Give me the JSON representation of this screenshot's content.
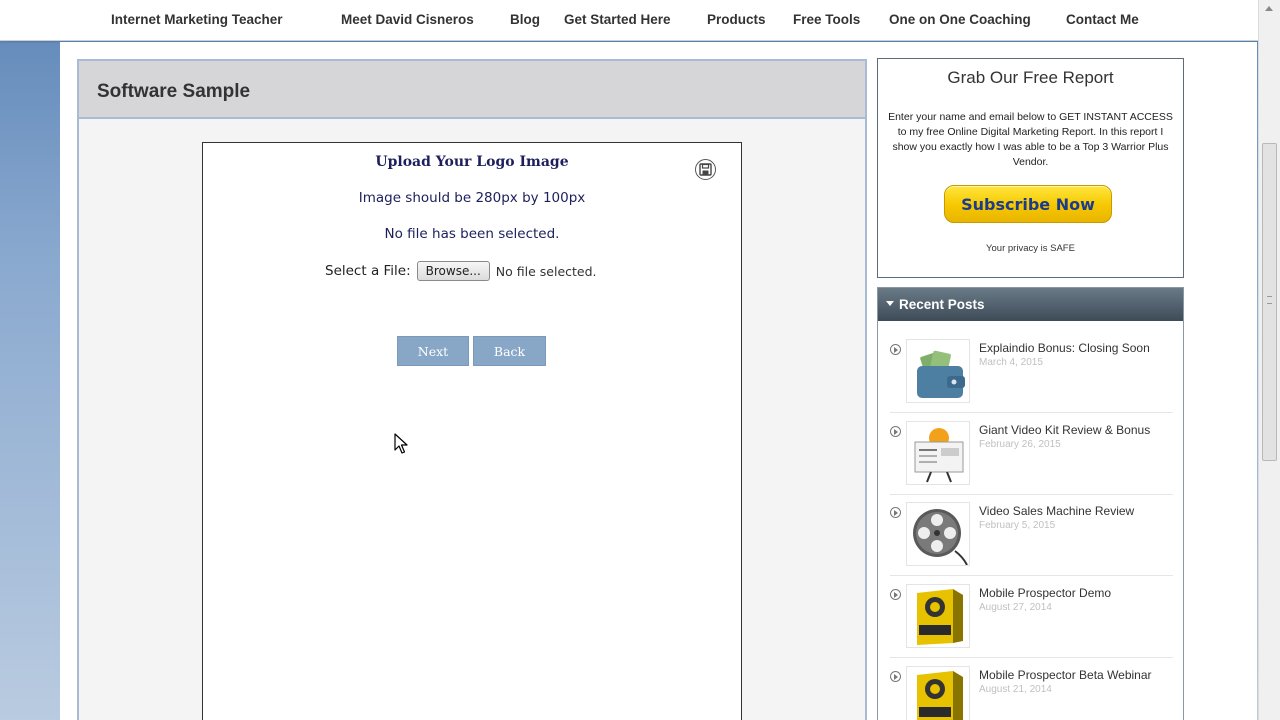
{
  "nav": {
    "items": [
      "Internet Marketing Teacher",
      "Meet David Cisneros",
      "Blog",
      "Get Started Here",
      "Products",
      "Free Tools",
      "One on One Coaching",
      "Contact Me"
    ]
  },
  "main": {
    "title": "Software Sample"
  },
  "software": {
    "heading": "Upload Your Logo Image",
    "size_hint": "Image should be 280px by 100px",
    "status": "No file has been selected.",
    "select_label": "Select a File:",
    "browse_label": "Browse...",
    "file_status": "No file selected.",
    "next_label": "Next",
    "back_label": "Back",
    "save_icon": "save-icon"
  },
  "report": {
    "title": "Grab Our Free Report",
    "text": "Enter your name and email below to GET INSTANT ACCESS to my free Online Digital Marketing Report. In this report I show you exactly how I was able to be a Top 3 Warrior Plus Vendor.",
    "button_label": "Subscribe Now",
    "privacy": "Your privacy is SAFE"
  },
  "recent_posts": {
    "title": "Recent Posts",
    "items": [
      {
        "title": "Explaindio Bonus: Closing Soon",
        "date": "March 4, 2015",
        "icon": "wallet-icon"
      },
      {
        "title": "Giant Video Kit Review & Bonus",
        "date": "February 26, 2015",
        "icon": "newspaper-icon"
      },
      {
        "title": "Video Sales Machine Review",
        "date": "February 5, 2015",
        "icon": "film-reel-icon"
      },
      {
        "title": "Mobile Prospector Demo",
        "date": "August 27, 2014",
        "icon": "product-box-icon"
      },
      {
        "title": "Mobile Prospector Beta Webinar",
        "date": "August 21, 2014",
        "icon": "product-box-icon"
      }
    ]
  },
  "colors": {
    "accent_blue": "#88a7c6",
    "heading_navy": "#1c1f5c",
    "subscribe_yellow": "#f6c700",
    "recent_header": "#3d4b57"
  }
}
